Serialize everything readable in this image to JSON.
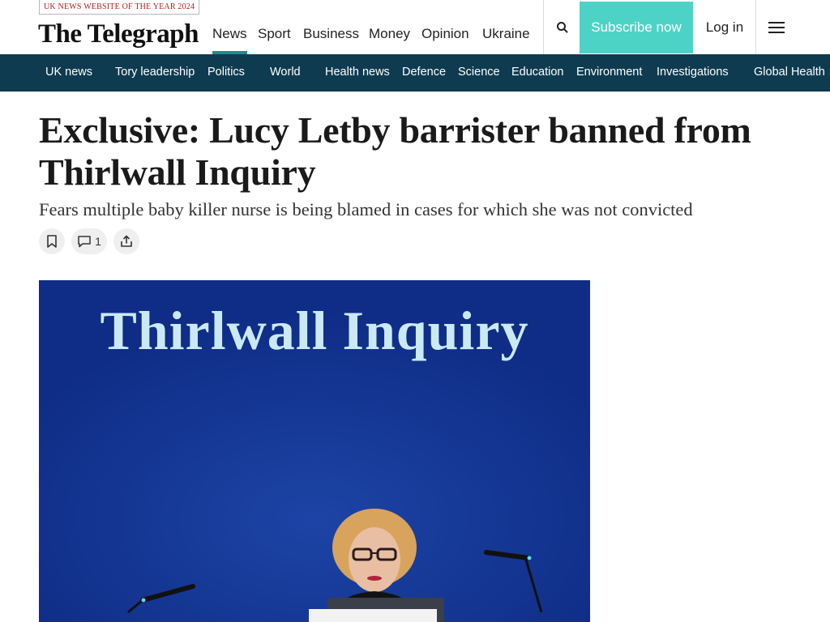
{
  "header": {
    "award": "UK NEWS WEBSITE OF THE YEAR 2024",
    "logo": "The Telegraph",
    "nav": [
      "News",
      "Sport",
      "Business",
      "Money",
      "Opinion",
      "Ukraine"
    ],
    "active_nav": "News",
    "search_icon": "search-icon",
    "subscribe_label": "Subscribe now",
    "login_label": "Log in",
    "menu_icon": "hamburger-menu-icon"
  },
  "subnav": {
    "items": [
      "UK news",
      "Tory leadership",
      "Politics",
      "World",
      "Health news",
      "Defence",
      "Science",
      "Education",
      "Environment",
      "Investigations",
      "Global Health"
    ]
  },
  "article": {
    "headline": "Exclusive: Lucy Letby barrister banned from Thirlwall Inquiry",
    "standfirst": "Fears multiple baby killer nurse is being blamed in cases for which she was not convicted",
    "comment_count": "1",
    "image": {
      "backdrop_text": "Thirlwall Inquiry"
    }
  },
  "colors": {
    "accent": "#4dd3c6",
    "nav_underline": "#1b8e8b",
    "subnav_bg": "#0f3b50",
    "award_text": "#b3201b"
  }
}
